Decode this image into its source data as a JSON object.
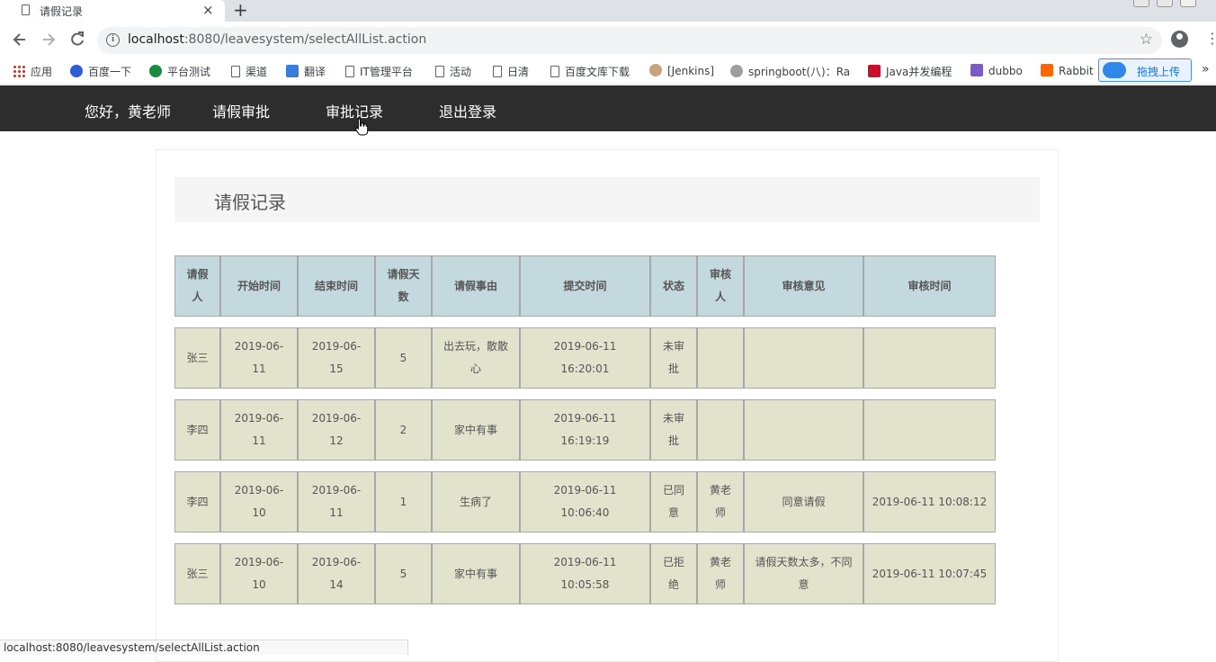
{
  "browser": {
    "tab_title": "请假记录",
    "new_tab_glyph": "+",
    "close_glyph": "×",
    "url_host": "localhost",
    "url_rest": ":8080/leavesystem/selectAllList.action",
    "status_url": "localhost:8080/leavesystem/selectAllList.action"
  },
  "bookmarks": [
    {
      "label": "应用",
      "icon": "apps-icon"
    },
    {
      "label": "百度一下",
      "icon": "baidu-icon"
    },
    {
      "label": "平台测试",
      "icon": "platform-icon"
    },
    {
      "label": "渠道",
      "icon": "page-icon"
    },
    {
      "label": "翻译",
      "icon": "translate-icon"
    },
    {
      "label": "IT管理平台",
      "icon": "page-icon"
    },
    {
      "label": "活动",
      "icon": "page-icon"
    },
    {
      "label": "日清",
      "icon": "page-icon"
    },
    {
      "label": "百度文库下载",
      "icon": "page-icon"
    },
    {
      "label": "[Jenkins]",
      "icon": "jenkins-icon"
    },
    {
      "label": "springboot(八)：Ra",
      "icon": "springboot-icon"
    },
    {
      "label": "Java并发编程",
      "icon": "csdn-icon"
    },
    {
      "label": "dubbo",
      "icon": "dubbo-icon"
    },
    {
      "label": "Rabbit",
      "icon": "rabbit-icon"
    }
  ],
  "upload_button": "拖拽上传",
  "nav": {
    "greeting": "您好，黄老师",
    "approve": "请假审批",
    "records": "审批记录",
    "logout": "退出登录"
  },
  "page_title": "请假记录",
  "table": {
    "headers": [
      "请假人",
      "开始时间",
      "结束时间",
      "请假天数",
      "请假事由",
      "提交时间",
      "状态",
      "审核人",
      "审核意见",
      "审核时间"
    ],
    "rows": [
      [
        "张三",
        "2019-06-11",
        "2019-06-15",
        "5",
        "出去玩，散散心",
        "2019-06-11 16:20:01",
        "未审批",
        "",
        "",
        ""
      ],
      [
        "李四",
        "2019-06-11",
        "2019-06-12",
        "2",
        "家中有事",
        "2019-06-11 16:19:19",
        "未审批",
        "",
        "",
        ""
      ],
      [
        "李四",
        "2019-06-10",
        "2019-06-11",
        "1",
        "生病了",
        "2019-06-11 10:06:40",
        "已同意",
        "黄老师",
        "同意请假",
        "2019-06-11 10:08:12"
      ],
      [
        "张三",
        "2019-06-10",
        "2019-06-14",
        "5",
        "家中有事",
        "2019-06-11 10:05:58",
        "已拒绝",
        "黄老师",
        "请假天数太多，不同意",
        "2019-06-11 10:07:45"
      ]
    ]
  }
}
